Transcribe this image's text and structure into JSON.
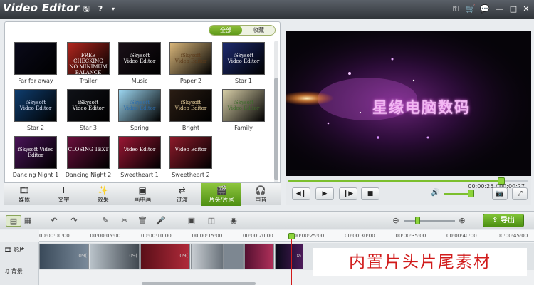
{
  "window": {
    "title": "Video Editor",
    "title_icons": [
      "save-icon",
      "help-icon",
      "dropdown-icon"
    ],
    "right_icons": [
      "key-icon",
      "cart-icon",
      "chat-icon",
      "minimize-icon",
      "maximize-icon",
      "close-icon"
    ]
  },
  "library": {
    "filter_tabs": [
      "全部",
      "收藏"
    ],
    "active_filter": "全部",
    "items": [
      {
        "label": "Far far away",
        "text": "",
        "bg": "#0a0a1a",
        "fg": "#e9c04a"
      },
      {
        "label": "Trailer",
        "text": "FREE CHECKING\nNO MINIMUM BALANCE FEES",
        "bg": "#b3261e",
        "fg": "#ffffff"
      },
      {
        "label": "Music",
        "text": "iSkysoft\nVideo Editor",
        "bg": "#1a1018",
        "fg": "#ffffff"
      },
      {
        "label": "Paper 2",
        "text": "iSkysoft\nVideo Editor",
        "bg": "#d9b67a",
        "fg": "#5b3a1a"
      },
      {
        "label": "Star 1",
        "text": "iSkysoft\nVideo Editor",
        "bg": "#1d2a6e",
        "fg": "#ffffff"
      },
      {
        "label": "Star 2",
        "text": "iSkysoft\nVideo Editor",
        "bg": "#0f3d6e",
        "fg": "#dfe8ff"
      },
      {
        "label": "Star 3",
        "text": "iSkysoft\nVideo Editor",
        "bg": "#101218",
        "fg": "#ffffff"
      },
      {
        "label": "Spring",
        "text": "iSkysoft\nVideo Editor",
        "bg": "#9cd6f1",
        "fg": "#2a6db0"
      },
      {
        "label": "Bright",
        "text": "iSkysoft\nVideo Editor",
        "bg": "#2a1d14",
        "fg": "#f2d9a3"
      },
      {
        "label": "Family",
        "text": "iSkysoft\nVideo Editor",
        "bg": "#d8cfa8",
        "fg": "#3c6b2a"
      },
      {
        "label": "Dancing Night 1",
        "text": "iSkysoft Video Editor",
        "bg": "#4a1458",
        "fg": "#ffffff"
      },
      {
        "label": "Dancing Night 2",
        "text": "CLOSING TEXT",
        "bg": "#6a0f3c",
        "fg": "#ffffff"
      },
      {
        "label": "Sweetheart 1",
        "text": "Video Editor",
        "bg": "#9b1634",
        "fg": "#ffffff"
      },
      {
        "label": "Sweetheart 2",
        "text": "Video Editor",
        "bg": "#8c1a2a",
        "fg": "#ffffff"
      }
    ]
  },
  "tabs": [
    {
      "label": "媒体",
      "icon": "film-icon"
    },
    {
      "label": "文字",
      "icon": "text-icon"
    },
    {
      "label": "效果",
      "icon": "wand-icon"
    },
    {
      "label": "画中画",
      "icon": "pip-icon"
    },
    {
      "label": "过渡",
      "icon": "transition-icon"
    },
    {
      "label": "片头/片尾",
      "icon": "intro-icon"
    },
    {
      "label": "声音",
      "icon": "headphones-icon"
    }
  ],
  "active_tab": "片头/片尾",
  "preview": {
    "overlay_text": "星缘电脑数码",
    "time": "00:00:25 / 00:00:27",
    "progress": 0.89,
    "volume": 0.8
  },
  "toolbar": {
    "export_label": "导出",
    "zoom": 0.25
  },
  "timeline": {
    "ticks": [
      "00:00:00:00",
      "00:00:05:00",
      "00:00:10:00",
      "00:00:15:00",
      "00:00:20:00",
      "00:00:25:00",
      "00:00:30:00",
      "00:00:35:00",
      "00:00:40:00",
      "00:00:45:00"
    ],
    "video_track_label": "影片",
    "audio_track_label": "背景",
    "clip_labels": [
      "09(",
      "09(",
      "09(",
      "",
      "",
      "Da"
    ],
    "caption": "内置片头片尾素材"
  },
  "colors": {
    "accent": "#6fb32a",
    "playhead": "#d21b1b",
    "caption": "#d11b1b"
  }
}
